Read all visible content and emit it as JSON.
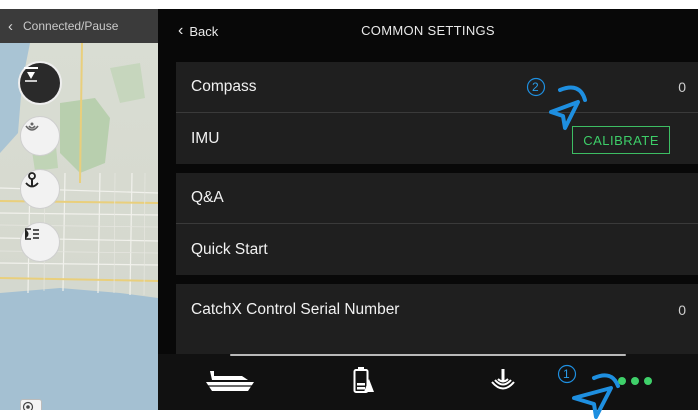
{
  "left_panel": {
    "header_text": "Connected/Pause",
    "buttons": [
      "sonar-mode-icon",
      "sonar-icon",
      "anchor-icon",
      "light-icon"
    ],
    "locate_icon": "crosshair-icon"
  },
  "top_bar": {
    "back_label": "Back",
    "title": "COMMON SETTINGS"
  },
  "groups": [
    {
      "rows": [
        {
          "label": "Compass",
          "value": "0"
        },
        {
          "label": "IMU",
          "button": "CALIBRATE"
        }
      ]
    },
    {
      "rows": [
        {
          "label": "Q&A"
        },
        {
          "label": "Quick Start"
        }
      ]
    },
    {
      "rows": [
        {
          "label": "CatchX Control Serial Number",
          "value": "0"
        }
      ]
    }
  ],
  "bottom_nav": {
    "icons": [
      "boat-icon",
      "battery-icon",
      "sonar-icon",
      "more-icon"
    ]
  },
  "annotations": [
    {
      "number": "1"
    },
    {
      "number": "2"
    }
  ],
  "colors": {
    "accent_green": "#3dcd68",
    "annotation_blue": "#1e8fe0",
    "background": "#080808",
    "row_bg": "#1f1f1f"
  }
}
